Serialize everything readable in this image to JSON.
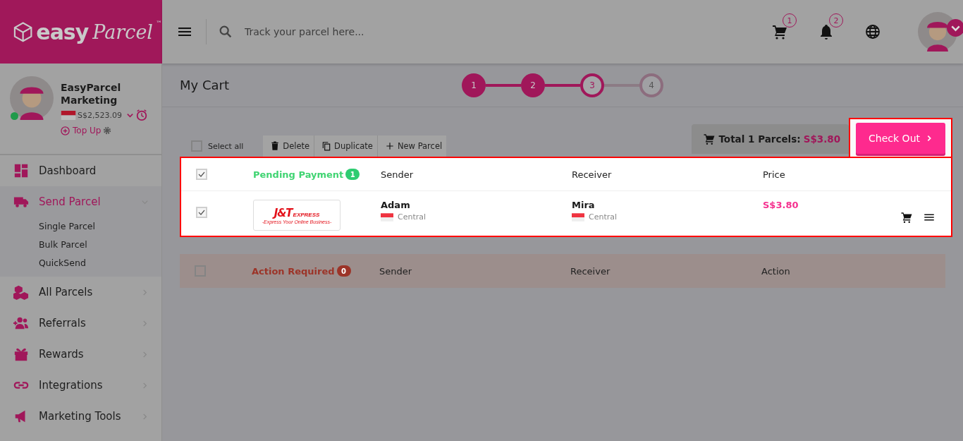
{
  "brand": {
    "word": "easy",
    "script": "Parcel",
    "mark": "™"
  },
  "topbar": {
    "search_placeholder": "Track your parcel here...",
    "cart_count": "1",
    "notification_count": "2"
  },
  "profile": {
    "name": "EasyParcel Marketing",
    "balance": "S$2,523.09",
    "online": true,
    "top_up": "Top Up"
  },
  "nav": [
    {
      "label": "Dashboard",
      "selected": false,
      "expandable": false
    },
    {
      "label": "Send Parcel",
      "selected": true,
      "expandable": true,
      "expanded": true,
      "children": [
        {
          "label": "Single Parcel"
        },
        {
          "label": "Bulk Parcel"
        },
        {
          "label": "QuickSend"
        }
      ]
    },
    {
      "label": "All Parcels",
      "selected": false,
      "expandable": true,
      "expanded": false
    },
    {
      "label": "Referrals",
      "selected": false,
      "expandable": true,
      "expanded": false
    },
    {
      "label": "Rewards",
      "selected": false,
      "expandable": true,
      "expanded": false
    },
    {
      "label": "Integrations",
      "selected": false,
      "expandable": true,
      "expanded": false
    },
    {
      "label": "Marketing Tools",
      "selected": false,
      "expandable": true,
      "expanded": false
    }
  ],
  "page_title": "My Cart",
  "steps": [
    {
      "label": "1",
      "kind": "done"
    },
    {
      "label": "2",
      "kind": "done"
    },
    {
      "label": "3",
      "kind": "current"
    },
    {
      "label": "4",
      "kind": "todo"
    }
  ],
  "toolbar": {
    "select_all": {
      "label": "Select all",
      "checked": false
    },
    "actions": [
      {
        "label": "Delete"
      },
      {
        "label": "Duplicate"
      },
      {
        "label": "New Parcel"
      }
    ]
  },
  "total": {
    "label": "Total 1 Parcels:",
    "amount": "S$3.80"
  },
  "checkout": {
    "label": "Check Out",
    "highlighted": true
  },
  "sections": [
    {
      "kind": "pending",
      "title": "Pending Payment",
      "count": "1",
      "checked": true,
      "highlighted": true,
      "columns": [
        "Sender",
        "Receiver",
        "Price"
      ],
      "rows": [
        {
          "checked": true,
          "courier": {
            "name": "J&T",
            "tag": "EXPRESS",
            "slogan": "-Express Your Online Business-"
          },
          "sender": "Adam",
          "sender_area": "Central",
          "receiver": "Mira",
          "receiver_area": "Central",
          "price": "S$3.80"
        }
      ]
    },
    {
      "kind": "action",
      "title": "Action Required",
      "count": "0",
      "checked": false,
      "highlighted": false,
      "columns": [
        "Sender",
        "Receiver",
        "Action"
      ]
    }
  ]
}
